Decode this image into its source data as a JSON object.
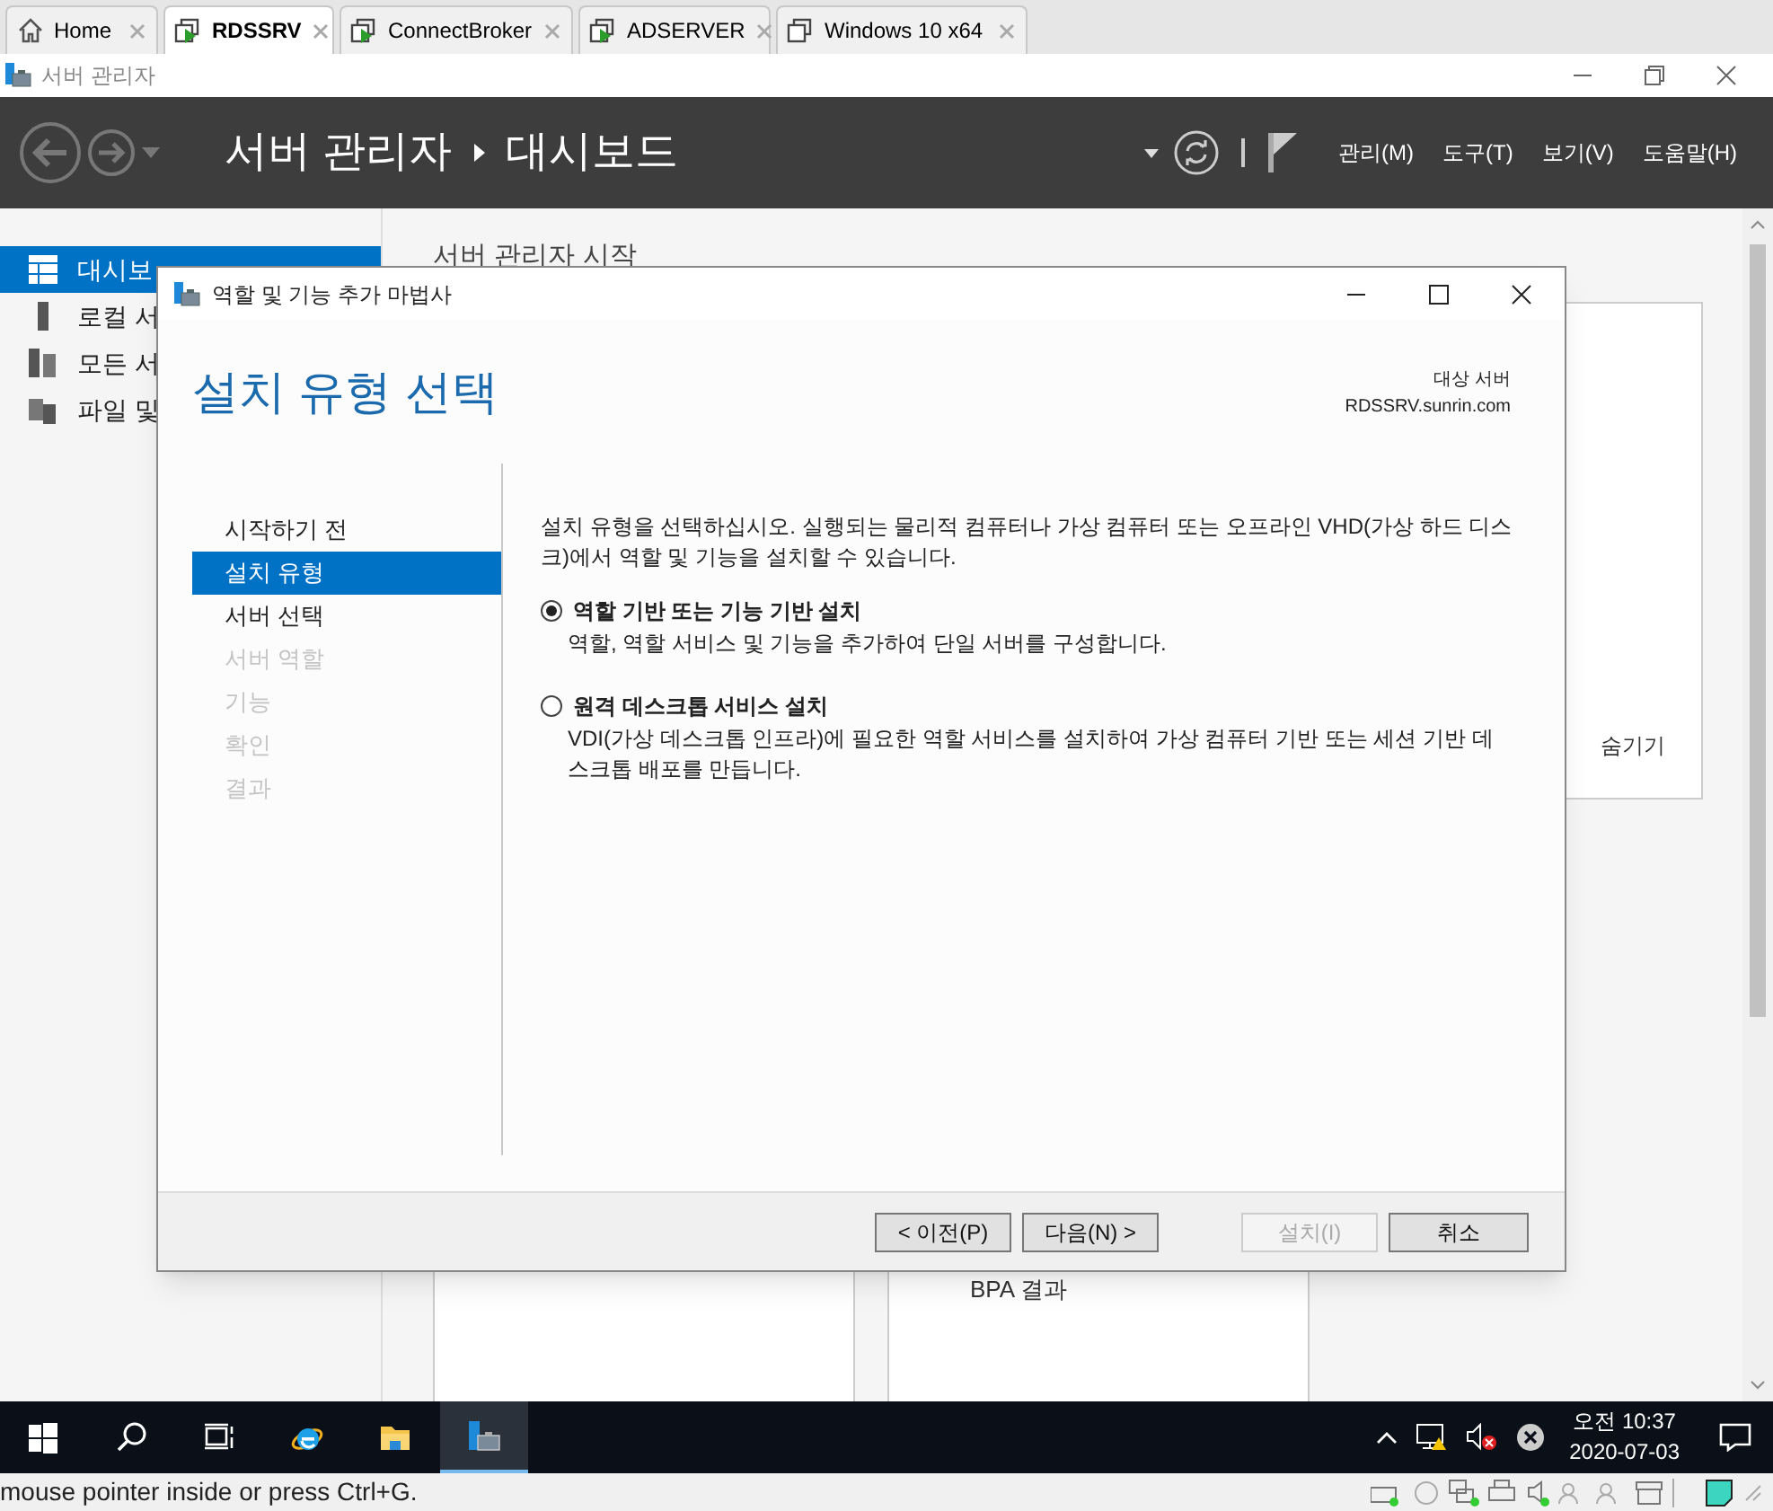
{
  "browser_tabs": [
    {
      "label": "Home",
      "kind": "home",
      "selected": false
    },
    {
      "label": "RDSSRV",
      "kind": "vm",
      "selected": true
    },
    {
      "label": "ConnectBroker",
      "kind": "vm",
      "selected": false
    },
    {
      "label": "ADSERVER",
      "kind": "vm",
      "selected": false
    },
    {
      "label": "Windows 10 x64",
      "kind": "vm-off",
      "selected": false
    }
  ],
  "window": {
    "title": "서버 관리자"
  },
  "header": {
    "breadcrumb": [
      "서버 관리자",
      "대시보드"
    ],
    "menus": [
      "관리(M)",
      "도구(T)",
      "보기(V)",
      "도움말(H)"
    ]
  },
  "sidebar": {
    "items": [
      {
        "label": "대시보",
        "kind": "dashboard",
        "selected": true
      },
      {
        "label": "로컬 서",
        "kind": "local",
        "selected": false
      },
      {
        "label": "모든 서",
        "kind": "all",
        "selected": false
      },
      {
        "label": "파일 및",
        "kind": "files",
        "selected": false
      }
    ]
  },
  "dashboard": {
    "heading": "서버 관리자 시작",
    "hide_link": "숨기기",
    "tile_label": "BPA 결과"
  },
  "wizard": {
    "title": "역할 및 기능 추가 마법사",
    "heading": "설치 유형 선택",
    "target_label": "대상 서버",
    "target_server": "RDSSRV.sunrin.com",
    "steps": [
      {
        "label": "시작하기 전",
        "selected": false,
        "disabled": false
      },
      {
        "label": "설치 유형",
        "selected": true,
        "disabled": false
      },
      {
        "label": "서버 선택",
        "selected": false,
        "disabled": false
      },
      {
        "label": "서버 역할",
        "selected": false,
        "disabled": true
      },
      {
        "label": "기능",
        "selected": false,
        "disabled": true
      },
      {
        "label": "확인",
        "selected": false,
        "disabled": true
      },
      {
        "label": "결과",
        "selected": false,
        "disabled": true
      }
    ],
    "description": "설치 유형을 선택하십시오. 실행되는 물리적 컴퓨터나 가상 컴퓨터 또는 오프라인 VHD(가상 하드 디스크)에서 역할 및 기능을 설치할 수 있습니다.",
    "options": [
      {
        "label": "역할 기반 또는 기능 기반 설치",
        "description": "역할, 역할 서비스 및 기능을 추가하여 단일 서버를 구성합니다.",
        "selected": true
      },
      {
        "label": "원격 데스크톱 서비스 설치",
        "description": "VDI(가상 데스크톱 인프라)에 필요한 역할 서비스를 설치하여 가상 컴퓨터 기반 또는 세션 기반 데스크톱 배포를 만듭니다.",
        "selected": false
      }
    ],
    "buttons": [
      {
        "label": "< 이전(P)",
        "disabled": false
      },
      {
        "label": "다음(N) >",
        "disabled": false
      },
      {
        "label": "설치(I)",
        "disabled": true
      },
      {
        "label": "취소",
        "disabled": false
      }
    ]
  },
  "taskbar": {
    "apps": [
      {
        "kind": "start",
        "active": false
      },
      {
        "kind": "search",
        "active": false
      },
      {
        "kind": "taskview",
        "active": false
      },
      {
        "kind": "browser",
        "active": false
      },
      {
        "kind": "folder",
        "active": false
      },
      {
        "kind": "servermanager",
        "active": true
      }
    ],
    "time": "오전 10:37",
    "date": "2020-07-03"
  },
  "status_bar": {
    "text": "mouse pointer inside or press Ctrl+G."
  }
}
